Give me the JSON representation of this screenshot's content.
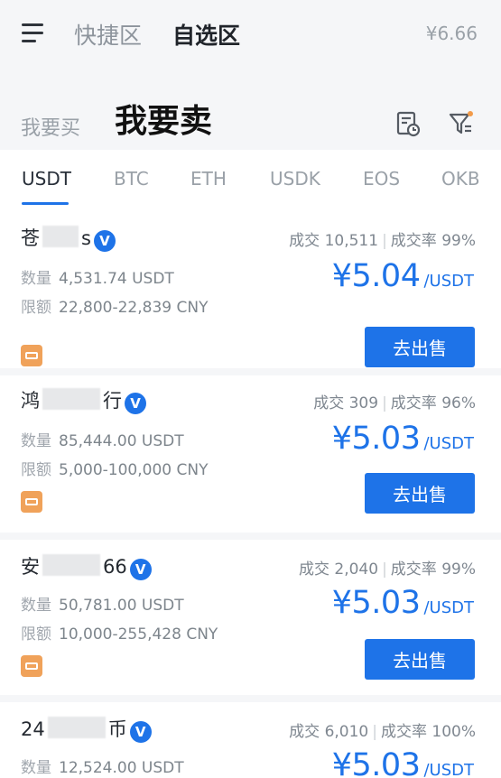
{
  "header": {
    "tabs": [
      "快捷区",
      "自选区"
    ],
    "balance": "¥6.66"
  },
  "mode": {
    "buy": "我要买",
    "sell": "我要卖"
  },
  "coins": [
    "USDT",
    "BTC",
    "ETH",
    "USDK",
    "EOS",
    "OKB"
  ],
  "ads": [
    {
      "name_prefix": "苍",
      "name_suffix": "s",
      "deals_label": "成交",
      "deals": "10,511",
      "rate_label": "成交率",
      "rate": "99%",
      "quantity_label": "数量",
      "quantity": "4,531.74 USDT",
      "limit_label": "限额",
      "limit": "22,800-22,839 CNY",
      "price": "¥5.04",
      "unit": "/USDT",
      "button": "去出售",
      "verified": "V"
    },
    {
      "name_prefix": "鸿",
      "name_suffix": "行",
      "deals_label": "成交",
      "deals": "309",
      "rate_label": "成交率",
      "rate": "96%",
      "quantity_label": "数量",
      "quantity": "85,444.00 USDT",
      "limit_label": "限额",
      "limit": "5,000-100,000 CNY",
      "price": "¥5.03",
      "unit": "/USDT",
      "button": "去出售",
      "verified": "V"
    },
    {
      "name_prefix": "安",
      "name_suffix": "66",
      "deals_label": "成交",
      "deals": "2,040",
      "rate_label": "成交率",
      "rate": "99%",
      "quantity_label": "数量",
      "quantity": "50,781.00 USDT",
      "limit_label": "限额",
      "limit": "10,000-255,428 CNY",
      "price": "¥5.03",
      "unit": "/USDT",
      "button": "去出售",
      "verified": "V"
    },
    {
      "name_prefix": "24",
      "name_suffix": "币",
      "deals_label": "成交",
      "deals": "6,010",
      "rate_label": "成交率",
      "rate": "100%",
      "quantity_label": "数量",
      "quantity": "12,524.00 USDT",
      "price": "¥5.03",
      "unit": "/USDT",
      "verified": "V"
    }
  ]
}
